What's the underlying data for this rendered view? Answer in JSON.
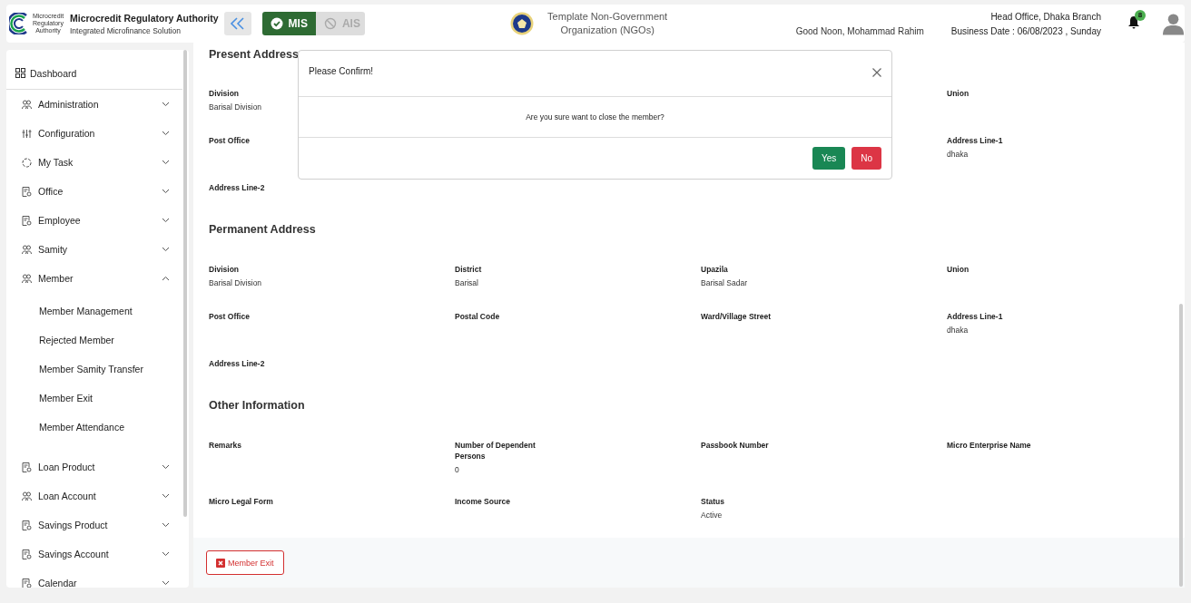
{
  "header": {
    "logo_text": "Microcredit Regulatory Authority",
    "title": "Microcredit Regulatory Authority",
    "subtitle": "Integrated Microfinance Solution",
    "modules": [
      {
        "label": "MIS",
        "selected": true
      },
      {
        "label": "AIS",
        "selected": false
      }
    ],
    "organization": "Template Non-Government Organization (NGOs)",
    "greeting": "Good Noon, Mohammad Rahim",
    "branch": "Head Office, Dhaka Branch",
    "business_date": "Business Date : 06/08/2023 , Sunday",
    "notification_count": "8"
  },
  "sidebar": {
    "dashboard": "Dashboard",
    "items": [
      {
        "label": "Administration",
        "expanded": false
      },
      {
        "label": "Configuration",
        "expanded": false
      },
      {
        "label": "My Task",
        "expanded": false
      },
      {
        "label": "Office",
        "expanded": false
      },
      {
        "label": "Employee",
        "expanded": false
      },
      {
        "label": "Samity",
        "expanded": false
      },
      {
        "label": "Member",
        "expanded": true,
        "children": [
          "Member Management",
          "Rejected Member",
          "Member Samity Transfer",
          "Member Exit",
          "Member Attendance"
        ]
      },
      {
        "label": "Loan Product",
        "expanded": false
      },
      {
        "label": "Loan Account",
        "expanded": false
      },
      {
        "label": "Savings Product",
        "expanded": false
      },
      {
        "label": "Savings Account",
        "expanded": false
      },
      {
        "label": "Calendar",
        "expanded": false
      }
    ]
  },
  "sections": [
    {
      "title": "Present Address",
      "rows": [
        [
          {
            "label": "Division",
            "value": "Barisal Division"
          },
          null,
          null,
          {
            "label": "Union"
          }
        ],
        [
          {
            "label": "Post Office"
          },
          null,
          null,
          {
            "label": "Address Line-1",
            "value": "dhaka"
          }
        ],
        [
          {
            "label": "Address Line-2"
          }
        ]
      ]
    },
    {
      "title": "Permanent Address",
      "rows": [
        [
          {
            "label": "Division",
            "value": "Barisal Division"
          },
          {
            "label": "District",
            "value": "Barisal"
          },
          {
            "label": "Upazila",
            "value": "Barisal Sadar"
          },
          {
            "label": "Union"
          }
        ],
        [
          {
            "label": "Post Office"
          },
          {
            "label": "Postal Code"
          },
          {
            "label": "Ward/Village Street"
          },
          {
            "label": "Address Line-1",
            "value": "dhaka"
          }
        ],
        [
          {
            "label": "Address Line-2"
          }
        ]
      ]
    },
    {
      "title": "Other Information",
      "rows": [
        [
          {
            "label": "Remarks"
          },
          {
            "label": "Number of Dependent Persons",
            "value": "0"
          },
          {
            "label": "Passbook Number"
          },
          {
            "label": "Micro Enterprise Name"
          }
        ],
        [
          {
            "label": "Micro Legal Form"
          },
          {
            "label": "Income Source"
          },
          {
            "label": "Status",
            "value": "Active"
          }
        ]
      ]
    }
  ],
  "footer_button": "Member Exit",
  "dialog": {
    "title": "Please Confirm!",
    "message": "Are you sure want to close the member?",
    "buttons": [
      {
        "label": "Yes",
        "kind": "confirm"
      },
      {
        "label": "No",
        "kind": "cancel"
      }
    ]
  }
}
